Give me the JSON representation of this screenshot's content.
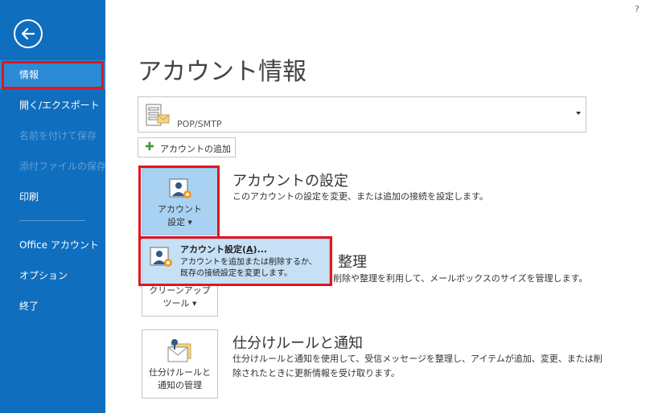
{
  "sidebar": {
    "back_icon": "back-arrow-icon",
    "items": [
      {
        "label": "情報"
      },
      {
        "label": "開く/エクスポート"
      },
      {
        "label": "名前を付けて保存"
      },
      {
        "label": "添付ファイルの保存"
      },
      {
        "label": "印刷"
      },
      {
        "label": "Office アカウント"
      },
      {
        "label": "オプション"
      },
      {
        "label": "終了"
      }
    ]
  },
  "header": {
    "help": "?",
    "title": "アカウント情報"
  },
  "account_selector": {
    "value": "POP/SMTP"
  },
  "add_account": {
    "label": "アカウントの追加"
  },
  "sections": {
    "account_settings": {
      "button_line1": "アカウント",
      "button_line2": "設定",
      "title": "アカウントの設定",
      "description": "このアカウントの設定を変更、または追加の接続を設定します。"
    },
    "cleanup": {
      "title_partial": "整理",
      "description_partial": "削除や整理を利用して、メールボックスのサイズを管理します。",
      "button_line1": "クリーンアップ",
      "button_line2": "ツール"
    },
    "rules": {
      "button_line1": "仕分けルールと",
      "button_line2": "通知の管理",
      "title": "仕分けルールと通知",
      "description_line1": "仕分けルールと通知を使用して、受信メッセージを整理し、アイテムが追加、変更、または削",
      "description_line2": "除されたときに更新情報を受け取ります。"
    }
  },
  "popup": {
    "title_prefix": "アカウント設定(",
    "title_accel": "A",
    "title_suffix": ")...",
    "desc_line1": "アカウントを追加または削除するか、",
    "desc_line2": "既存の接続設定を変更します。"
  },
  "colors": {
    "sidebar_bg": "#106ebe",
    "sidebar_selected": "#2a8ad4",
    "highlight_red": "#e0161e",
    "popup_bg": "#c6e0f5",
    "active_tile": "#a9d2f2"
  }
}
